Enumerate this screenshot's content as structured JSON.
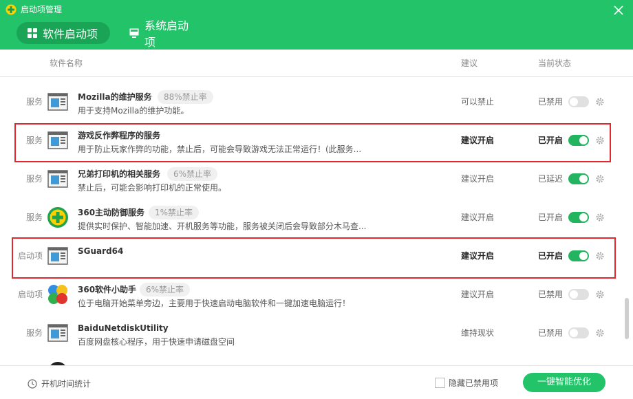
{
  "window": {
    "title": "启动项管理",
    "close_icon": "close-icon",
    "accent_color": "#23c36a"
  },
  "tabs": [
    {
      "label": "软件启动项",
      "icon": "grid-icon",
      "active": true
    },
    {
      "label": "系统启动项",
      "icon": "monitor-icon",
      "active": false
    }
  ],
  "columns": {
    "name": "软件名称",
    "advice": "建议",
    "state": "当前状态"
  },
  "rows": [
    {
      "type": "服务",
      "icon": "service-window-icon",
      "name": "Mozilla的维护服务",
      "rate": "88%禁止率",
      "desc": "用于支持Mozilla的维护功能。",
      "advice": "可以禁止",
      "state": "已禁用",
      "enabled": false,
      "highlighted": false
    },
    {
      "type": "服务",
      "icon": "service-window-icon",
      "name": "游戏反作弊程序的服务",
      "rate": "",
      "desc": "用于防止玩家作弊的功能，禁止后，可能会导致游戏无法正常运行！(此服务...",
      "advice": "建议开启",
      "state": "已开启",
      "enabled": true,
      "highlighted": true
    },
    {
      "type": "服务",
      "icon": "service-window-icon",
      "name": "兄弟打印机的相关服务",
      "rate": "6%禁止率",
      "desc": "禁止后，可能会影响打印机的正常使用。",
      "advice": "建议开启",
      "state": "已延迟",
      "enabled": true,
      "highlighted": false
    },
    {
      "type": "服务",
      "icon": "shield-plus-icon",
      "name": "360主动防御服务",
      "rate": "1%禁止率",
      "desc": "提供实时保护、智能加速、开机服务等功能，服务被关闭后会导致部分木马查...",
      "advice": "建议开启",
      "state": "已开启",
      "enabled": true,
      "highlighted": false
    },
    {
      "type": "启动项",
      "icon": "service-window-icon",
      "name": "SGuard64",
      "rate": "",
      "desc": "",
      "advice": "建议开启",
      "state": "已开启",
      "enabled": true,
      "highlighted": true
    },
    {
      "type": "启动项",
      "icon": "four-color-balls-icon",
      "name": "360软件小助手",
      "rate": "6%禁止率",
      "desc": "位于电脑开始菜单旁边，主要用于快速启动电脑软件和一键加速电脑运行！",
      "advice": "建议开启",
      "state": "已禁用",
      "enabled": false,
      "highlighted": false
    },
    {
      "type": "服务",
      "icon": "service-window-icon",
      "name": "BaiduNetdiskUtility",
      "rate": "",
      "desc": "百度网盘核心程序，用于快速申请磁盘空间",
      "advice": "维持现状",
      "state": "已禁用",
      "enabled": false,
      "highlighted": false
    }
  ],
  "footer": {
    "stats_label": "开机时间统计",
    "stats_icon": "clock-icon",
    "hide_disabled_label": "隐藏已禁用项",
    "hide_disabled_checked": false,
    "optimize_label": "一键智能优化"
  }
}
